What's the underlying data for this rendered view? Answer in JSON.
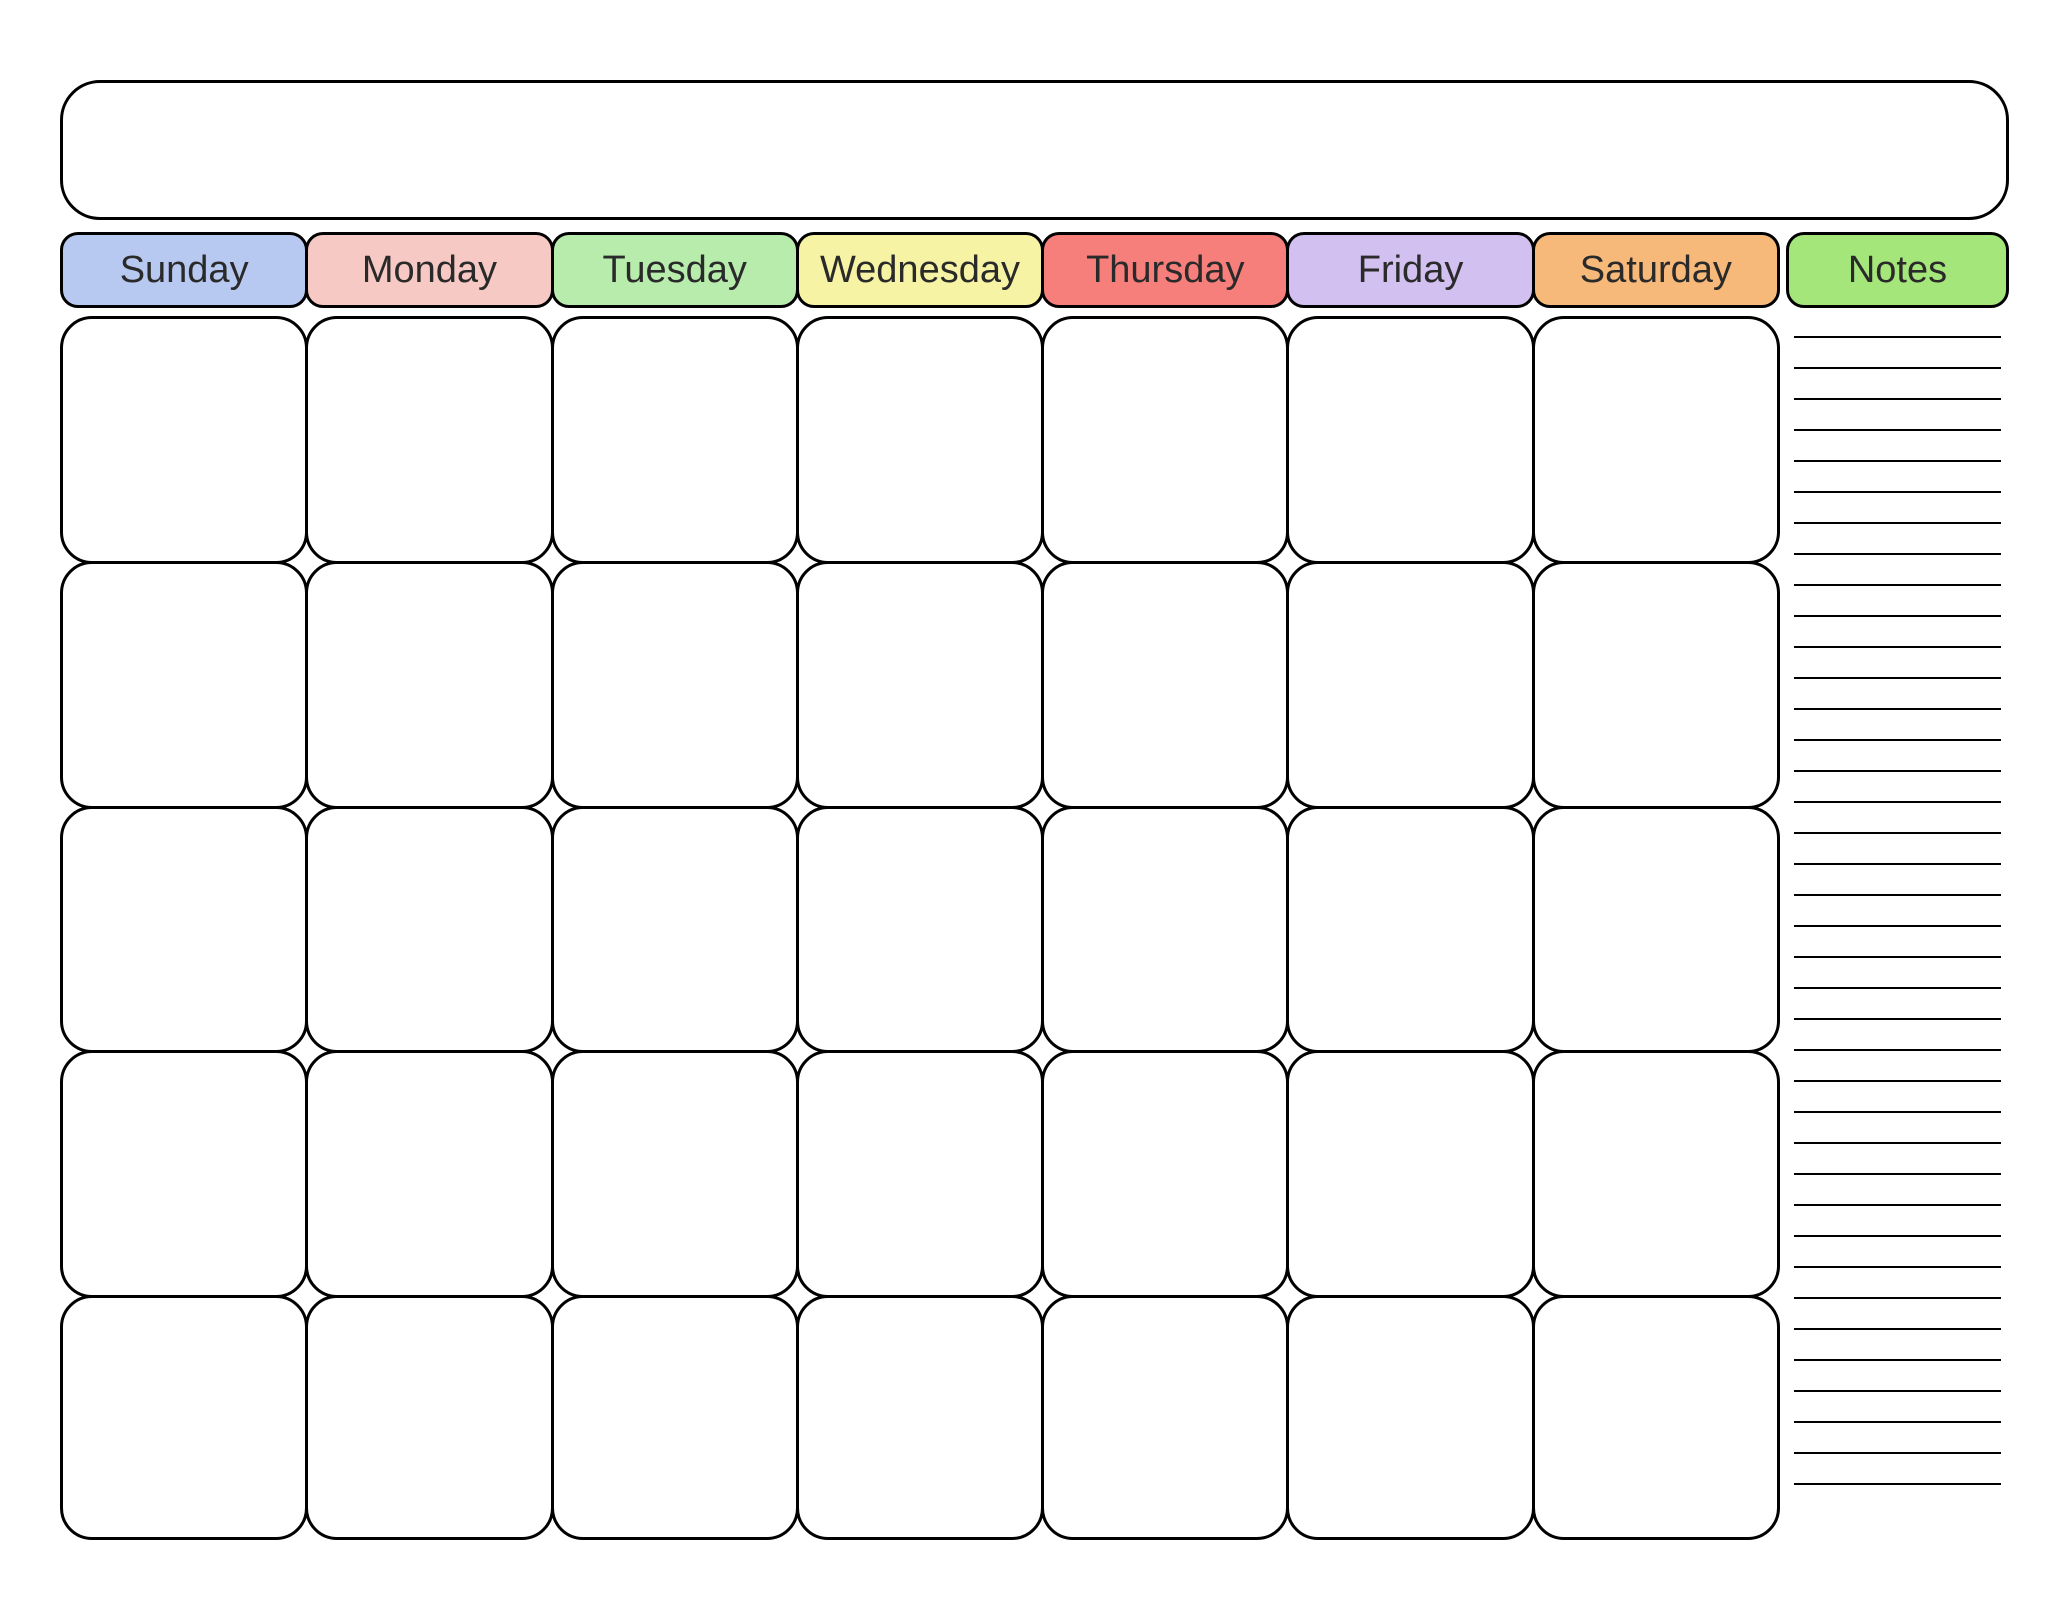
{
  "calendar": {
    "title": "",
    "days": [
      {
        "label": "Sunday",
        "color": "#b8c9f1"
      },
      {
        "label": "Monday",
        "color": "#f7c9c4"
      },
      {
        "label": "Tuesday",
        "color": "#b7ecac"
      },
      {
        "label": "Wednesday",
        "color": "#f6f3a4"
      },
      {
        "label": "Thursday",
        "color": "#f77f7b"
      },
      {
        "label": "Friday",
        "color": "#d1c0f0"
      },
      {
        "label": "Saturday",
        "color": "#f6b97a"
      }
    ],
    "rows": 5,
    "cols": 7
  },
  "notes": {
    "label": "Notes",
    "color": "#a5e67b",
    "line_count": 38
  }
}
